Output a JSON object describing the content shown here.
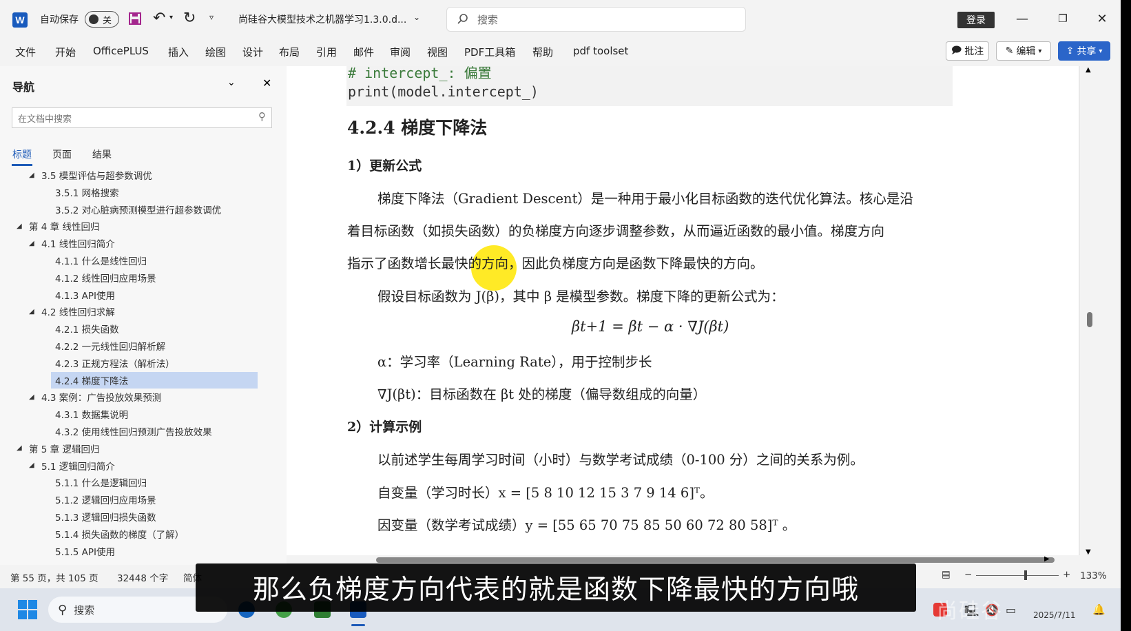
{
  "titlebar": {
    "autosave_label": "自动保存",
    "autosave_state": "关",
    "doc_title": "尚硅谷大模型技术之机器学习1.3.0.d...",
    "search_placeholder": "搜索",
    "login_label": "登录"
  },
  "menubar": {
    "items": [
      "文件",
      "开始",
      "OfficePLUS",
      "插入",
      "绘图",
      "设计",
      "布局",
      "引用",
      "邮件",
      "审阅",
      "视图",
      "PDF工具箱",
      "帮助",
      "pdf toolset"
    ],
    "comment_label": "批注",
    "edit_label": "编辑",
    "share_label": "共享"
  },
  "nav": {
    "title": "导航",
    "search_placeholder": "在文档中搜索",
    "tabs": [
      "标题",
      "页面",
      "结果"
    ],
    "items": [
      {
        "label": "3.5 模型评估与超参数调优",
        "level": 2,
        "caret": true
      },
      {
        "label": "3.5.1 网格搜索",
        "level": 3
      },
      {
        "label": "3.5.2 对心脏病预测模型进行超参数调优",
        "level": 3
      },
      {
        "label": "第 4 章 线性回归",
        "level": 1,
        "caret": true
      },
      {
        "label": "4.1 线性回归简介",
        "level": 2,
        "caret": true
      },
      {
        "label": "4.1.1 什么是线性回归",
        "level": 3
      },
      {
        "label": "4.1.2 线性回归应用场景",
        "level": 3
      },
      {
        "label": "4.1.3 API使用",
        "level": 3
      },
      {
        "label": "4.2 线性回归求解",
        "level": 2,
        "caret": true
      },
      {
        "label": "4.2.1 损失函数",
        "level": 3
      },
      {
        "label": "4.2.2 一元线性回归解析解",
        "level": 3
      },
      {
        "label": "4.2.3 正规方程法（解析法）",
        "level": 3
      },
      {
        "label": "4.2.4 梯度下降法",
        "level": 3,
        "selected": true
      },
      {
        "label": "4.3 案例：广告投放效果预测",
        "level": 2,
        "caret": true
      },
      {
        "label": "4.3.1 数据集说明",
        "level": 3
      },
      {
        "label": "4.3.2 使用线性回归预测广告投放效果",
        "level": 3
      },
      {
        "label": "第 5 章 逻辑回归",
        "level": 1,
        "caret": true
      },
      {
        "label": "5.1 逻辑回归简介",
        "level": 2,
        "caret": true
      },
      {
        "label": "5.1.1 什么是逻辑回归",
        "level": 3
      },
      {
        "label": "5.1.2 逻辑回归应用场景",
        "level": 3
      },
      {
        "label": "5.1.3 逻辑回归损失函数",
        "level": 3
      },
      {
        "label": "5.1.4 损失函数的梯度（了解）",
        "level": 3
      },
      {
        "label": "5.1.5 API使用",
        "level": 3
      }
    ]
  },
  "doc": {
    "code_comment": "# intercept_: 偏置",
    "code_print": "print(model.intercept_)",
    "heading": "4.2.4 梯度下降法",
    "sub1": "1）更新公式",
    "para1_line1": "梯度下降法（Gradient Descent）是一种用于最小化目标函数的迭代优化算法。核心是沿",
    "para1_line2": "着目标函数（如损失函数）的负梯度方向逐步调整参数，从而逼近函数的最小值。梯度方向",
    "para1_line3": "指示了函数增长最快的方向，因此负梯度方向是函数下降最快的方向。",
    "para2": "假设目标函数为 J(β)，其中 β 是模型参数。梯度下降的更新公式为：",
    "formula": "βt+1 = βt − α · ∇J(βt)",
    "alpha_line": "α：学习率（Learning Rate），用于控制步长",
    "grad_line": "∇J(βt)：目标函数在 βt 处的梯度（偏导数组成的向量）",
    "sub2": "2）计算示例",
    "para3": "以前述学生每周学习时间（小时）与数学考试成绩（0-100 分）之间的关系为例。",
    "x_line": "自变量（学习时长）x = [5   8   10   12   15   3   7   9   14   6]ᵀ。",
    "y_line": "因变量（数学考试成绩）y = [55   65   70   75   85   50   60   72   80   58]ᵀ 。"
  },
  "status": {
    "page_info": "第 55 页，共 105 页",
    "word_count": "32448 个字",
    "lang": "简体",
    "zoom": "133%"
  },
  "taskbar": {
    "search_label": "搜索",
    "date": "2025/7/11",
    "watermark": "尚硅谷"
  },
  "subtitle": "那么负梯度方向代表的就是函数下降最快的方向哦"
}
